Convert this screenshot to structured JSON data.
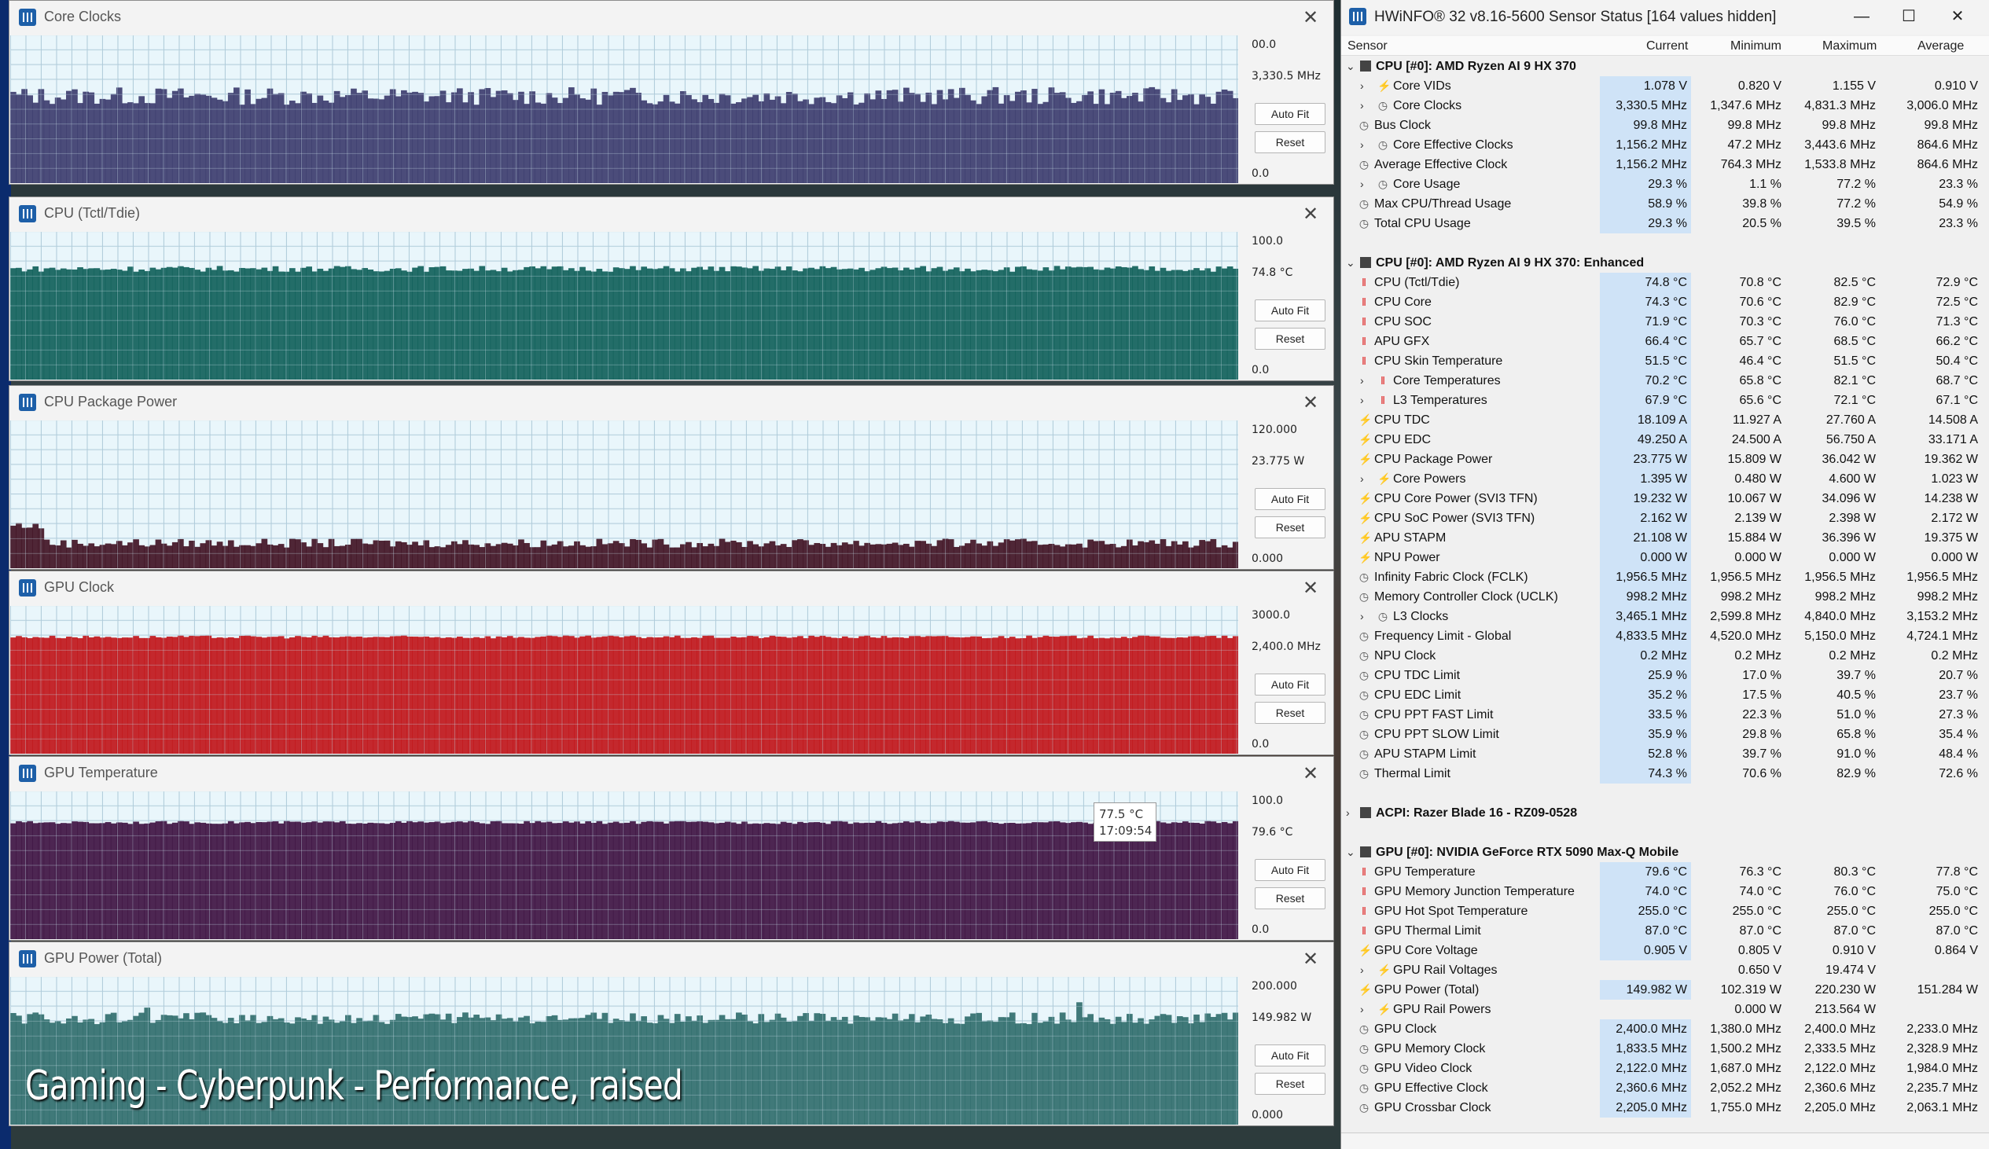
{
  "desktop": {
    "overlay_caption": "Gaming - Cyberpunk - Performance, raised"
  },
  "tooltip": {
    "value": "77.5 °C",
    "time": "17:09:54"
  },
  "graphs": [
    {
      "title": "Core Clocks",
      "ymax": "00.0",
      "current": "3,330.5 MHz",
      "ymin": "0.0",
      "autofit": "Auto Fit",
      "reset": "Reset",
      "color": "#3a3a6b",
      "fill_level": 0.59,
      "noise": 0.06,
      "spikes": []
    },
    {
      "title": "CPU (Tctl/Tdie)",
      "ymax": "100.0",
      "current": "74.8 °C",
      "ymin": "0.0",
      "autofit": "Auto Fit",
      "reset": "Reset",
      "color": "#0d5e58",
      "fill_level": 0.75,
      "noise": 0.02,
      "spikes": []
    },
    {
      "title": "CPU Package Power",
      "ymax": "120.000",
      "current": "23.775 W",
      "ymin": "0.000",
      "autofit": "Auto Fit",
      "reset": "Reset",
      "color": "#3e1020",
      "fill_level": 0.17,
      "noise": 0.03,
      "spikes": []
    },
    {
      "title": "GPU Clock",
      "ymax": "3000.0",
      "current": "2,400.0 MHz",
      "ymin": "0.0",
      "autofit": "Auto Fit",
      "reset": "Reset",
      "color": "#c01216",
      "fill_level": 0.79,
      "noise": 0.01,
      "spikes": []
    },
    {
      "title": "GPU Temperature",
      "ymax": "100.0",
      "current": "79.6 °C",
      "ymin": "0.0",
      "autofit": "Auto Fit",
      "reset": "Reset",
      "color": "#3c0f3f",
      "fill_level": 0.79,
      "noise": 0.01,
      "spikes": []
    },
    {
      "title": "GPU Power (Total)",
      "ymax": "200.000",
      "current": "149.982 W",
      "ymin": "0.000",
      "autofit": "Auto Fit",
      "reset": "Reset",
      "color": "#2d6c6a",
      "fill_level": 0.72,
      "noise": 0.04,
      "spikes": []
    }
  ],
  "hwinfo": {
    "title": "HWiNFO® 32 v8.16-5600 Sensor Status [164 values hidden]",
    "columns": {
      "sensor": "Sensor",
      "current": "Current",
      "minimum": "Minimum",
      "maximum": "Maximum",
      "average": "Average"
    },
    "rows": [
      {
        "t": "hdr",
        "exp": "v",
        "name": "CPU [#0]: AMD Ryzen AI 9 HX 370"
      },
      {
        "t": "bolt",
        "exp": ">",
        "ind": 1,
        "name": "Core VIDs",
        "cur": "1.078 V",
        "min": "0.820 V",
        "max": "1.155 V",
        "avg": "0.910 V"
      },
      {
        "t": "clock",
        "exp": ">",
        "ind": 1,
        "name": "Core Clocks",
        "cur": "3,330.5 MHz",
        "min": "1,347.6 MHz",
        "max": "4,831.3 MHz",
        "avg": "3,006.0 MHz"
      },
      {
        "t": "clock",
        "ind": 0,
        "name": "Bus Clock",
        "cur": "99.8 MHz",
        "min": "99.8 MHz",
        "max": "99.8 MHz",
        "avg": "99.8 MHz"
      },
      {
        "t": "clock",
        "exp": ">",
        "ind": 1,
        "name": "Core Effective Clocks",
        "cur": "1,156.2 MHz",
        "min": "47.2 MHz",
        "max": "3,443.6 MHz",
        "avg": "864.6 MHz"
      },
      {
        "t": "clock",
        "ind": 0,
        "name": "Average Effective Clock",
        "cur": "1,156.2 MHz",
        "min": "764.3 MHz",
        "max": "1,533.8 MHz",
        "avg": "864.6 MHz"
      },
      {
        "t": "clock",
        "exp": ">",
        "ind": 1,
        "name": "Core Usage",
        "cur": "29.3 %",
        "min": "1.1 %",
        "max": "77.2 %",
        "avg": "23.3 %"
      },
      {
        "t": "clock",
        "ind": 0,
        "name": "Max CPU/Thread Usage",
        "cur": "58.9 %",
        "min": "39.8 %",
        "max": "77.2 %",
        "avg": "54.9 %"
      },
      {
        "t": "clock",
        "ind": 0,
        "name": "Total CPU Usage",
        "cur": "29.3 %",
        "min": "20.5 %",
        "max": "39.5 %",
        "avg": "23.3 %"
      },
      {
        "t": "blank"
      },
      {
        "t": "hdr",
        "exp": "v",
        "name": "CPU [#0]: AMD Ryzen AI 9 HX 370: Enhanced"
      },
      {
        "t": "temp",
        "ind": 0,
        "name": "CPU (Tctl/Tdie)",
        "cur": "74.8 °C",
        "min": "70.8 °C",
        "max": "82.5 °C",
        "avg": "72.9 °C"
      },
      {
        "t": "temp",
        "ind": 0,
        "name": "CPU Core",
        "cur": "74.3 °C",
        "min": "70.6 °C",
        "max": "82.9 °C",
        "avg": "72.5 °C"
      },
      {
        "t": "temp",
        "ind": 0,
        "name": "CPU SOC",
        "cur": "71.9 °C",
        "min": "70.3 °C",
        "max": "76.0 °C",
        "avg": "71.3 °C"
      },
      {
        "t": "temp",
        "ind": 0,
        "name": "APU GFX",
        "cur": "66.4 °C",
        "min": "65.7 °C",
        "max": "68.5 °C",
        "avg": "66.2 °C"
      },
      {
        "t": "temp",
        "ind": 0,
        "name": "CPU Skin Temperature",
        "cur": "51.5 °C",
        "min": "46.4 °C",
        "max": "51.5 °C",
        "avg": "50.4 °C"
      },
      {
        "t": "temp",
        "exp": ">",
        "ind": 1,
        "name": "Core Temperatures",
        "cur": "70.2 °C",
        "min": "65.8 °C",
        "max": "82.1 °C",
        "avg": "68.7 °C"
      },
      {
        "t": "temp",
        "exp": ">",
        "ind": 1,
        "name": "L3 Temperatures",
        "cur": "67.9 °C",
        "min": "65.6 °C",
        "max": "72.1 °C",
        "avg": "67.1 °C"
      },
      {
        "t": "bolt",
        "ind": 0,
        "name": "CPU TDC",
        "cur": "18.109 A",
        "min": "11.927 A",
        "max": "27.760 A",
        "avg": "14.508 A"
      },
      {
        "t": "bolt",
        "ind": 0,
        "name": "CPU EDC",
        "cur": "49.250 A",
        "min": "24.500 A",
        "max": "56.750 A",
        "avg": "33.171 A"
      },
      {
        "t": "bolt",
        "ind": 0,
        "name": "CPU Package Power",
        "cur": "23.775 W",
        "min": "15.809 W",
        "max": "36.042 W",
        "avg": "19.362 W"
      },
      {
        "t": "bolt",
        "exp": ">",
        "ind": 1,
        "name": "Core Powers",
        "cur": "1.395 W",
        "min": "0.480 W",
        "max": "4.600 W",
        "avg": "1.023 W"
      },
      {
        "t": "bolt",
        "ind": 0,
        "name": "CPU Core Power (SVI3 TFN)",
        "cur": "19.232 W",
        "min": "10.067 W",
        "max": "34.096 W",
        "avg": "14.238 W"
      },
      {
        "t": "bolt",
        "ind": 0,
        "name": "CPU SoC Power (SVI3 TFN)",
        "cur": "2.162 W",
        "min": "2.139 W",
        "max": "2.398 W",
        "avg": "2.172 W"
      },
      {
        "t": "bolt",
        "ind": 0,
        "name": "APU STAPM",
        "cur": "21.108 W",
        "min": "15.884 W",
        "max": "36.396 W",
        "avg": "19.375 W"
      },
      {
        "t": "bolt",
        "ind": 0,
        "name": "NPU Power",
        "cur": "0.000 W",
        "min": "0.000 W",
        "max": "0.000 W",
        "avg": "0.000 W"
      },
      {
        "t": "clock",
        "ind": 0,
        "name": "Infinity Fabric Clock (FCLK)",
        "cur": "1,956.5 MHz",
        "min": "1,956.5 MHz",
        "max": "1,956.5 MHz",
        "avg": "1,956.5 MHz"
      },
      {
        "t": "clock",
        "ind": 0,
        "name": "Memory Controller Clock (UCLK)",
        "cur": "998.2 MHz",
        "min": "998.2 MHz",
        "max": "998.2 MHz",
        "avg": "998.2 MHz"
      },
      {
        "t": "clock",
        "exp": ">",
        "ind": 1,
        "name": "L3 Clocks",
        "cur": "3,465.1 MHz",
        "min": "2,599.8 MHz",
        "max": "4,840.0 MHz",
        "avg": "3,153.2 MHz"
      },
      {
        "t": "clock",
        "ind": 0,
        "name": "Frequency Limit - Global",
        "cur": "4,833.5 MHz",
        "min": "4,520.0 MHz",
        "max": "5,150.0 MHz",
        "avg": "4,724.1 MHz"
      },
      {
        "t": "clock",
        "ind": 0,
        "name": "NPU Clock",
        "cur": "0.2 MHz",
        "min": "0.2 MHz",
        "max": "0.2 MHz",
        "avg": "0.2 MHz"
      },
      {
        "t": "clock",
        "ind": 0,
        "name": "CPU TDC Limit",
        "cur": "25.9 %",
        "min": "17.0 %",
        "max": "39.7 %",
        "avg": "20.7 %"
      },
      {
        "t": "clock",
        "ind": 0,
        "name": "CPU EDC Limit",
        "cur": "35.2 %",
        "min": "17.5 %",
        "max": "40.5 %",
        "avg": "23.7 %"
      },
      {
        "t": "clock",
        "ind": 0,
        "name": "CPU PPT FAST Limit",
        "cur": "33.5 %",
        "min": "22.3 %",
        "max": "51.0 %",
        "avg": "27.3 %"
      },
      {
        "t": "clock",
        "ind": 0,
        "name": "CPU PPT SLOW Limit",
        "cur": "35.9 %",
        "min": "29.8 %",
        "max": "65.8 %",
        "avg": "35.4 %"
      },
      {
        "t": "clock",
        "ind": 0,
        "name": "APU STAPM Limit",
        "cur": "52.8 %",
        "min": "39.7 %",
        "max": "91.0 %",
        "avg": "48.4 %"
      },
      {
        "t": "clock",
        "ind": 0,
        "name": "Thermal Limit",
        "cur": "74.3 %",
        "min": "70.6 %",
        "max": "82.9 %",
        "avg": "72.6 %"
      },
      {
        "t": "blank"
      },
      {
        "t": "hdr",
        "exp": ">",
        "name": "ACPI: Razer Blade 16 - RZ09-0528"
      },
      {
        "t": "blank"
      },
      {
        "t": "hdr",
        "exp": "v",
        "name": "GPU [#0]: NVIDIA  GeForce RTX 5090 Max-Q Mobile"
      },
      {
        "t": "temp",
        "ind": 0,
        "name": "GPU Temperature",
        "cur": "79.6 °C",
        "min": "76.3 °C",
        "max": "80.3 °C",
        "avg": "77.8 °C"
      },
      {
        "t": "temp",
        "ind": 0,
        "name": "GPU Memory Junction Temperature",
        "cur": "74.0 °C",
        "min": "74.0 °C",
        "max": "76.0 °C",
        "avg": "75.0 °C"
      },
      {
        "t": "temp",
        "ind": 0,
        "name": "GPU Hot Spot Temperature",
        "cur": "255.0 °C",
        "min": "255.0 °C",
        "max": "255.0 °C",
        "avg": "255.0 °C"
      },
      {
        "t": "temp",
        "ind": 0,
        "name": "GPU Thermal Limit",
        "cur": "87.0 °C",
        "min": "87.0 °C",
        "max": "87.0 °C",
        "avg": "87.0 °C"
      },
      {
        "t": "bolt",
        "ind": 0,
        "name": "GPU Core Voltage",
        "cur": "0.905 V",
        "min": "0.805 V",
        "max": "0.910 V",
        "avg": "0.864 V"
      },
      {
        "t": "bolt",
        "exp": ">",
        "ind": 1,
        "name": "GPU Rail Voltages",
        "cur": "",
        "min": "0.650 V",
        "max": "19.474 V",
        "avg": ""
      },
      {
        "t": "bolt",
        "ind": 0,
        "name": "GPU Power (Total)",
        "cur": "149.982 W",
        "min": "102.319 W",
        "max": "220.230 W",
        "avg": "151.284 W"
      },
      {
        "t": "bolt",
        "exp": ">",
        "ind": 1,
        "name": "GPU Rail Powers",
        "cur": "",
        "min": "0.000 W",
        "max": "213.564 W",
        "avg": ""
      },
      {
        "t": "clock",
        "ind": 0,
        "name": "GPU Clock",
        "cur": "2,400.0 MHz",
        "min": "1,380.0 MHz",
        "max": "2,400.0 MHz",
        "avg": "2,233.0 MHz"
      },
      {
        "t": "clock",
        "ind": 0,
        "name": "GPU Memory Clock",
        "cur": "1,833.5 MHz",
        "min": "1,500.2 MHz",
        "max": "2,333.5 MHz",
        "avg": "2,328.9 MHz"
      },
      {
        "t": "clock",
        "ind": 0,
        "name": "GPU Video Clock",
        "cur": "2,122.0 MHz",
        "min": "1,687.0 MHz",
        "max": "2,122.0 MHz",
        "avg": "1,984.0 MHz"
      },
      {
        "t": "clock",
        "ind": 0,
        "name": "GPU Effective Clock",
        "cur": "2,360.6 MHz",
        "min": "2,052.2 MHz",
        "max": "2,360.6 MHz",
        "avg": "2,235.7 MHz"
      },
      {
        "t": "clock",
        "ind": 0,
        "name": "GPU Crossbar Clock",
        "cur": "2,205.0 MHz",
        "min": "1,755.0 MHz",
        "max": "2,205.0 MHz",
        "avg": "2,063.1 MHz"
      }
    ]
  }
}
